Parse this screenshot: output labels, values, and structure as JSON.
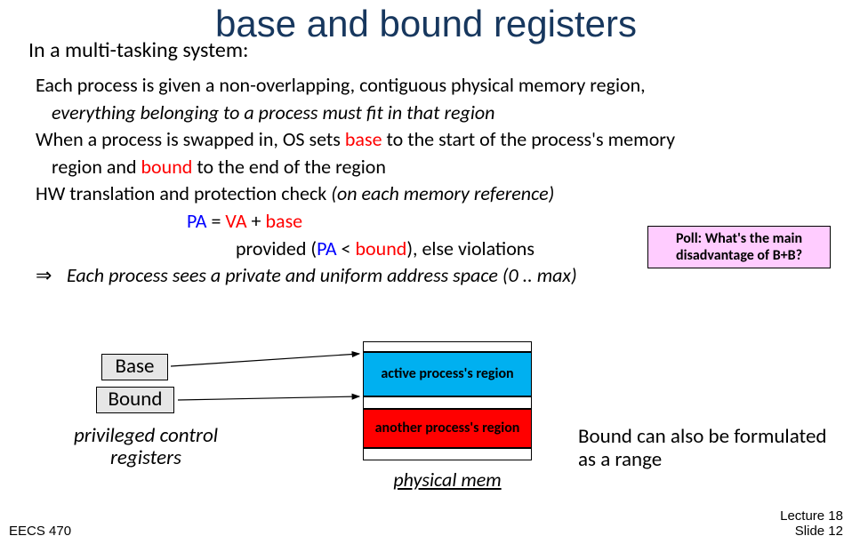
{
  "title": "base and bound registers",
  "subtitle": "In a multi-tasking system:",
  "body": {
    "line1": "Each process is given a non-overlapping, contiguous physical memory region,",
    "line1b": "everything belonging to a process must fit in that region",
    "line2a": "When a process is swapped in, OS sets ",
    "line2_base": "base",
    "line2b": " to the start of the process's memory",
    "line2c": "region and ",
    "line2_bound": "bound",
    "line2d": " to the end of the region",
    "line3a": "HW translation and protection check ",
    "line3b": "(on each memory reference)",
    "pa": "PA",
    "eq": " = ",
    "va": "VA",
    "plus": " + ",
    "base_word": "base",
    "prov_a": "provided (",
    "prov_pa": "PA",
    "prov_lt": " < ",
    "prov_bound": "bound",
    "prov_b": "), else violations",
    "arrow": "⇒",
    "concl": " Each process sees a private and uniform address space (0 .. max)"
  },
  "poll": {
    "line1": "Poll: What's the main",
    "line2": "disadvantage of B+B?"
  },
  "diagram": {
    "base": "Base",
    "bound": "Bound",
    "priv": "privileged control registers",
    "active": "active process's region",
    "another": "another process's region",
    "physmem": "physical mem",
    "note": "Bound can also be formulated as a range"
  },
  "footer": {
    "course": "EECS 470",
    "lecture": "Lecture 18",
    "slide": "Slide 12"
  }
}
